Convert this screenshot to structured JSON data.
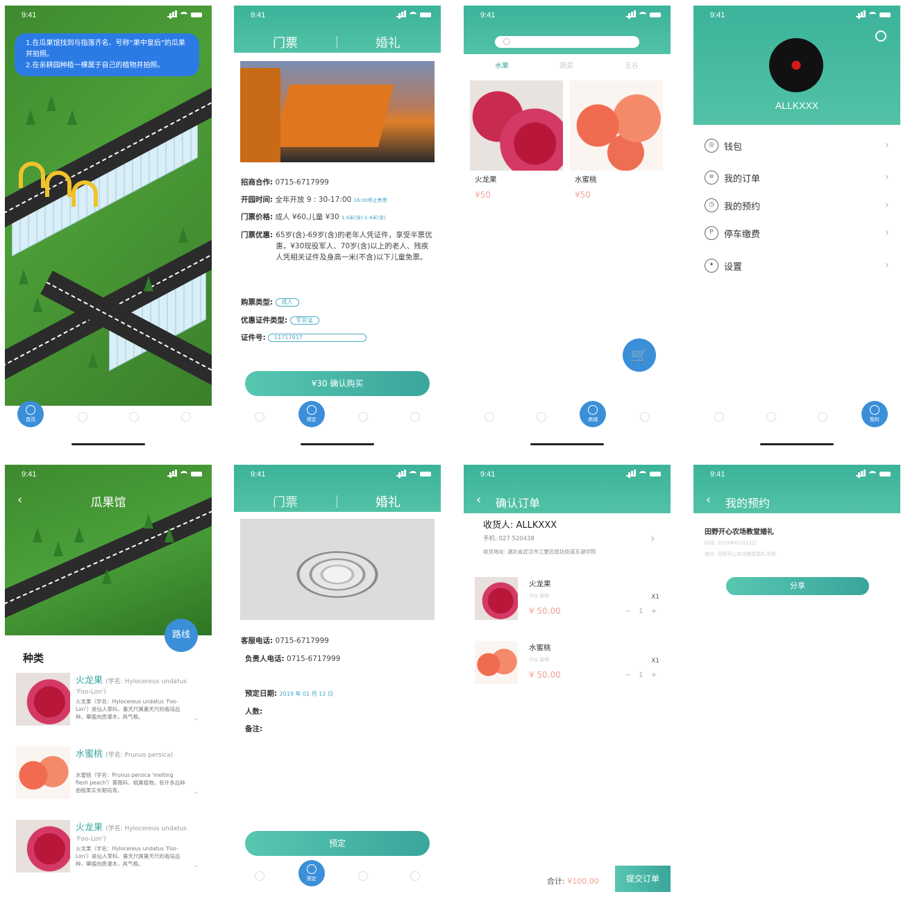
{
  "status": {
    "time": "9:41"
  },
  "tabs": {
    "home": "首页",
    "book": "预定",
    "buy": "商城",
    "mine": "我的",
    "t2": "",
    "t3": ""
  },
  "s1": {
    "tip_line1": "1.在瓜果馆找到与指落齐名、号称“果中皇后”的瓜果并拍照。",
    "tip_line2": "2.在亲耕园种植一棵属于自己的植物并拍照。"
  },
  "s2": {
    "seg_left": "门票",
    "seg_right": "婚礼",
    "coop_label": "招商合作:",
    "coop_value": "0715-6717999",
    "open_label": "开园时间:",
    "open_value": "全年开放 9 : 30-17:00",
    "open_note": "16:00停止售票",
    "price_label": "门票价格:",
    "price_value": "成人 ¥60,儿童 ¥30",
    "price_note": "1.0米(含)-1.4米(含)",
    "discount_label": "门票优惠:",
    "discount_value": "65岁(含)-69岁(含)的老年人凭证件，享受半票优惠，¥30现役军人、70岁(含)以上的老人、残疾人凭相关证件及身高一米(不含)以下儿童免票。",
    "type_label": "购票类型:",
    "type_value": "成人",
    "cert_label": "优惠证件类型:",
    "cert_value": "军官证",
    "idno_label": "证件号:",
    "idno_value": "11717917",
    "buy_button": "¥30 确认购买"
  },
  "s3": {
    "cat1": "水果",
    "cat2": "蔬菜",
    "cat3": "五谷",
    "item1_name": "火龙果",
    "item1_price": "¥50",
    "item2_name": "水蜜桃",
    "item2_price": "¥50",
    "cart_icon": "🛒"
  },
  "s4": {
    "username": "ALLKXXX",
    "menu": [
      "钱包",
      "我的订单",
      "我的预约",
      "停车缴费",
      "设置"
    ]
  },
  "s5": {
    "title": "瓜果馆",
    "route_button": "路线",
    "section": "种类",
    "species": [
      {
        "name": "火龙果",
        "latin": "(学名: Hylocereus undatus 'Foo-Lon')",
        "desc": "火龙果（学名：Hylocereus undatus 'Foo-Lon'）是仙人掌科、量天尺属量天尺的栽培品种，攀援肉质灌木，具气根。"
      },
      {
        "name": "水蜜桃",
        "latin": "(学名: Prunus persica)",
        "desc": "水蜜桃（学名：Prunus persica 'melting flesh peach'）蔷薇科、桃属植物。有许多品种由桃果实长期培育。"
      },
      {
        "name": "火龙果",
        "latin": "(学名: Hylocereus undatus 'Foo-Lon')",
        "desc": "火龙果（学名：Hylocereus undatus 'Foo-Lon'）是仙人掌科、量天尺属量天尺的栽培品种，攀援肉质灌木，具气根。"
      }
    ]
  },
  "s6": {
    "seg_left": "门票",
    "seg_right": "婚礼",
    "service_label": "客服电话:",
    "service_value": "0715-6717999",
    "manager_label": "负责人电话:",
    "manager_value": "0715-6717999",
    "date_label": "预定日期:",
    "date_value": "2019 年 01 月 12 日",
    "people_label": "人数:",
    "note_label": "备注:",
    "book_button": "预定"
  },
  "s7": {
    "title": "确认订单",
    "receiver": "收货人: ALLKXXX",
    "phone": "手机: 027 520438",
    "address": "收货地址: 湖北省武汉市江夏区纸坊街道东湖学院",
    "items": [
      {
        "name": "火龙果",
        "spec": "2kg 装箱",
        "price": "¥ 50.00",
        "qty": "X1"
      },
      {
        "name": "水蜜桃",
        "spec": "2kg 装箱",
        "price": "¥ 50.00",
        "qty": "X1"
      }
    ],
    "stepper": "− 1 +",
    "total_label": "合计:",
    "total_value": "¥100.00",
    "submit_button": "提交订单"
  },
  "s8": {
    "title": "我的预约",
    "item_title": "田野开心农场教堂婚礼",
    "meta1": "时间: 2019年01月12日",
    "meta2": "地点: 田野开心农场教堂婚礼场地",
    "share_button": "分享"
  },
  "colors": {
    "teal": "#3bb39a",
    "blue": "#3a8fd8",
    "price": "#f0a090"
  }
}
